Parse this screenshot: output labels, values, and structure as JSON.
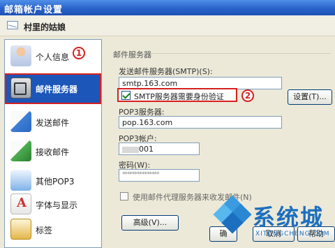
{
  "window": {
    "title": "邮箱帐户设置"
  },
  "account": {
    "name": "村里的姑娘"
  },
  "sidebar": {
    "items": [
      {
        "label": "个人信息",
        "icon": "person-icon"
      },
      {
        "label": "邮件服务器",
        "icon": "server-icon",
        "active": true
      },
      {
        "label": "发送邮件",
        "icon": "send-mail-icon"
      },
      {
        "label": "接收邮件",
        "icon": "receive-mail-icon"
      },
      {
        "label": "其他POP3",
        "icon": "pop3-icon"
      },
      {
        "label": "字体与显示",
        "icon": "font-icon"
      },
      {
        "label": "标签",
        "icon": "tag-icon"
      }
    ]
  },
  "annotations": {
    "one": "1",
    "two": "2"
  },
  "server": {
    "section_title": "邮件服务器",
    "smtp_label": "发送邮件服务器(SMTP)(S):",
    "smtp_value": "smtp.163.com",
    "smtp_auth_label": "SMTP服务器需要身份验证",
    "settings_button": "设置(T)...",
    "pop3_label": "POP3服务器:",
    "pop3_value": "pop.163.com",
    "pop3_account_label": "POP3帐户:",
    "pop3_account_value": "001",
    "password_label": "密码(W):",
    "password_value": "***************",
    "proxy_label": "使用邮件代理服务器来收发邮件(N)",
    "advanced_button": "高级(V)..."
  },
  "footer": {
    "ok_button": "确",
    "cancel_button": "取消",
    "help_button": "帮助"
  },
  "watermark": {
    "text": "系统城",
    "sub": "XITONGCHENG.COM"
  },
  "colors": {
    "titlebar": "#2a63c9",
    "active_nav": "#1c56b8",
    "highlight": "#d62020",
    "watermark": "#1c6fbf"
  }
}
